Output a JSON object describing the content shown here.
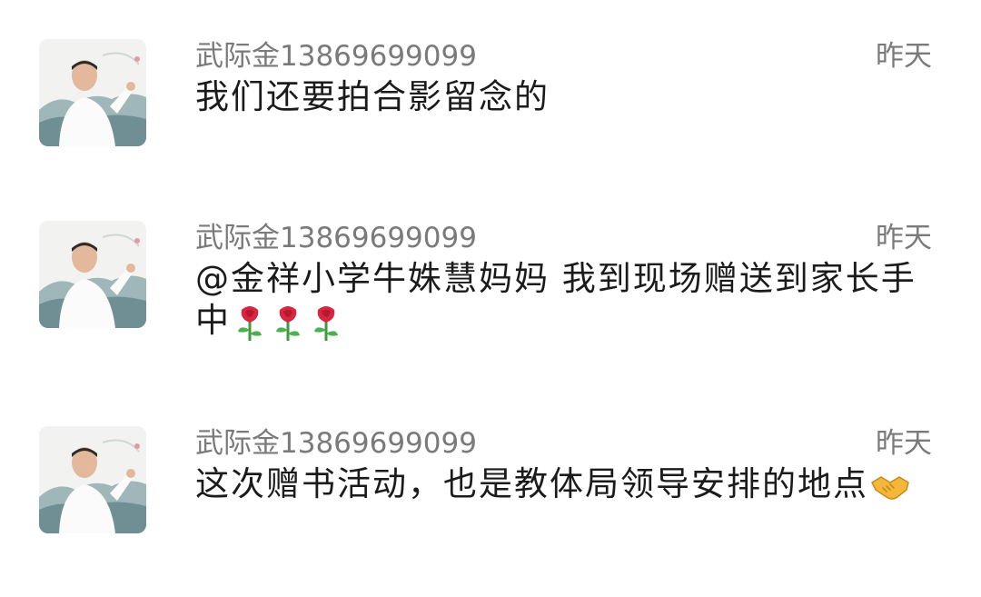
{
  "comments": [
    {
      "author": "武际金13869699099",
      "time": "昨天",
      "text": "我们还要拍合影留念的",
      "emojis": []
    },
    {
      "author": "武际金13869699099",
      "time": "昨天",
      "text": "@金祥小学牛姝慧妈妈 我到现场赠送到家长手中",
      "emojis": [
        "rose-icon",
        "rose-icon",
        "rose-icon"
      ]
    },
    {
      "author": "武际金13869699099",
      "time": "昨天",
      "text": "这次赠书活动，也是教体局领导安排的地点",
      "emojis": [
        "handshake-icon"
      ]
    }
  ],
  "colors": {
    "meta_text": "#7a7a7a",
    "body_text": "#1b1b1b",
    "background": "#ffffff"
  }
}
